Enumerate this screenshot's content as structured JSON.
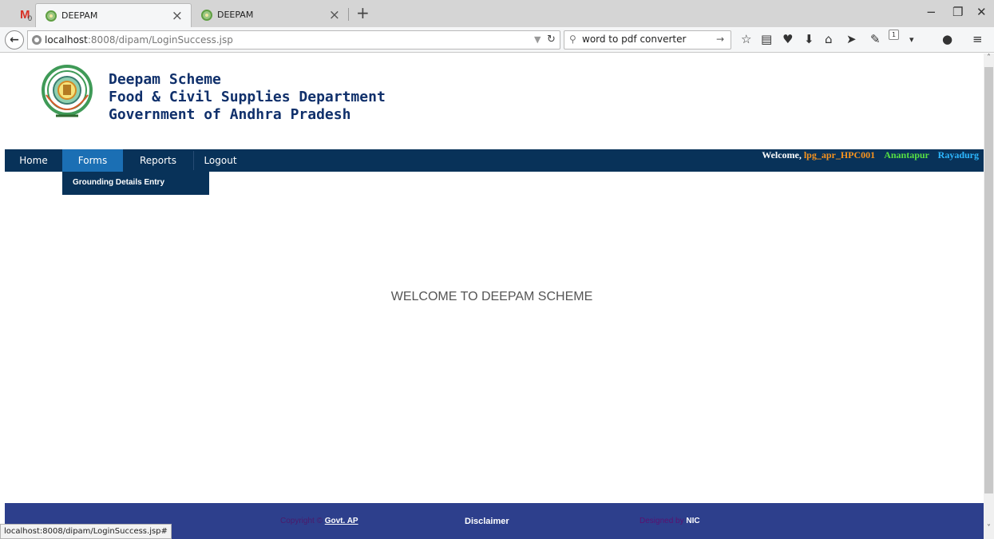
{
  "browser": {
    "gmail_tab": {
      "icon": "gmail-icon",
      "count": "0"
    },
    "tabs": [
      {
        "title": "DEEPAM",
        "active": true
      },
      {
        "title": "DEEPAM",
        "active": false
      }
    ],
    "close_tab_glyph": "×",
    "new_tab_glyph": "+",
    "window_controls": {
      "minimize": "−",
      "restore": "❐",
      "close": "✕"
    },
    "url": {
      "host": "localhost",
      "rest": ":8008/dipam/LoginSuccess.jsp"
    },
    "search": {
      "value": "word to pdf converter"
    },
    "toolbar_icons": [
      "star-icon",
      "reading-list-icon",
      "pocket-icon",
      "download-icon",
      "home-icon",
      "share-icon",
      "extension-icon",
      "overflow-icon",
      "chat-icon",
      "menu-icon"
    ],
    "badge_count": "1",
    "status_url": "localhost:8008/dipam/LoginSuccess.jsp#"
  },
  "header": {
    "line1": "Deepam Scheme",
    "line2": "Food & Civil Supplies Department",
    "line3": "Government of Andhra Pradesh"
  },
  "menu": {
    "home": "Home",
    "forms": "Forms",
    "reports": "Reports",
    "logout": "Logout",
    "submenu_item": "Grounding Details Entry"
  },
  "welcome": {
    "prefix": "Welcome,",
    "user": "lpg_apr_HPC001",
    "district": "Anantapur",
    "mandal": "Rayadurg"
  },
  "main": {
    "message": "WELCOME TO DEEPAM SCHEME"
  },
  "footer": {
    "copyright": "Copyright ©",
    "govt_link": "Govt. AP",
    "disclaimer": "Disclaimer",
    "designed_by": "Designed by",
    "nic_link": "NIC"
  },
  "colors": {
    "menu_bg": "#083259",
    "menu_active": "#1b6fb4",
    "footer_bg": "#2d3f8c",
    "header_text": "#10306b",
    "user_color": "#f7931e",
    "district_color": "#57e043",
    "mandal_color": "#2db7ff"
  }
}
